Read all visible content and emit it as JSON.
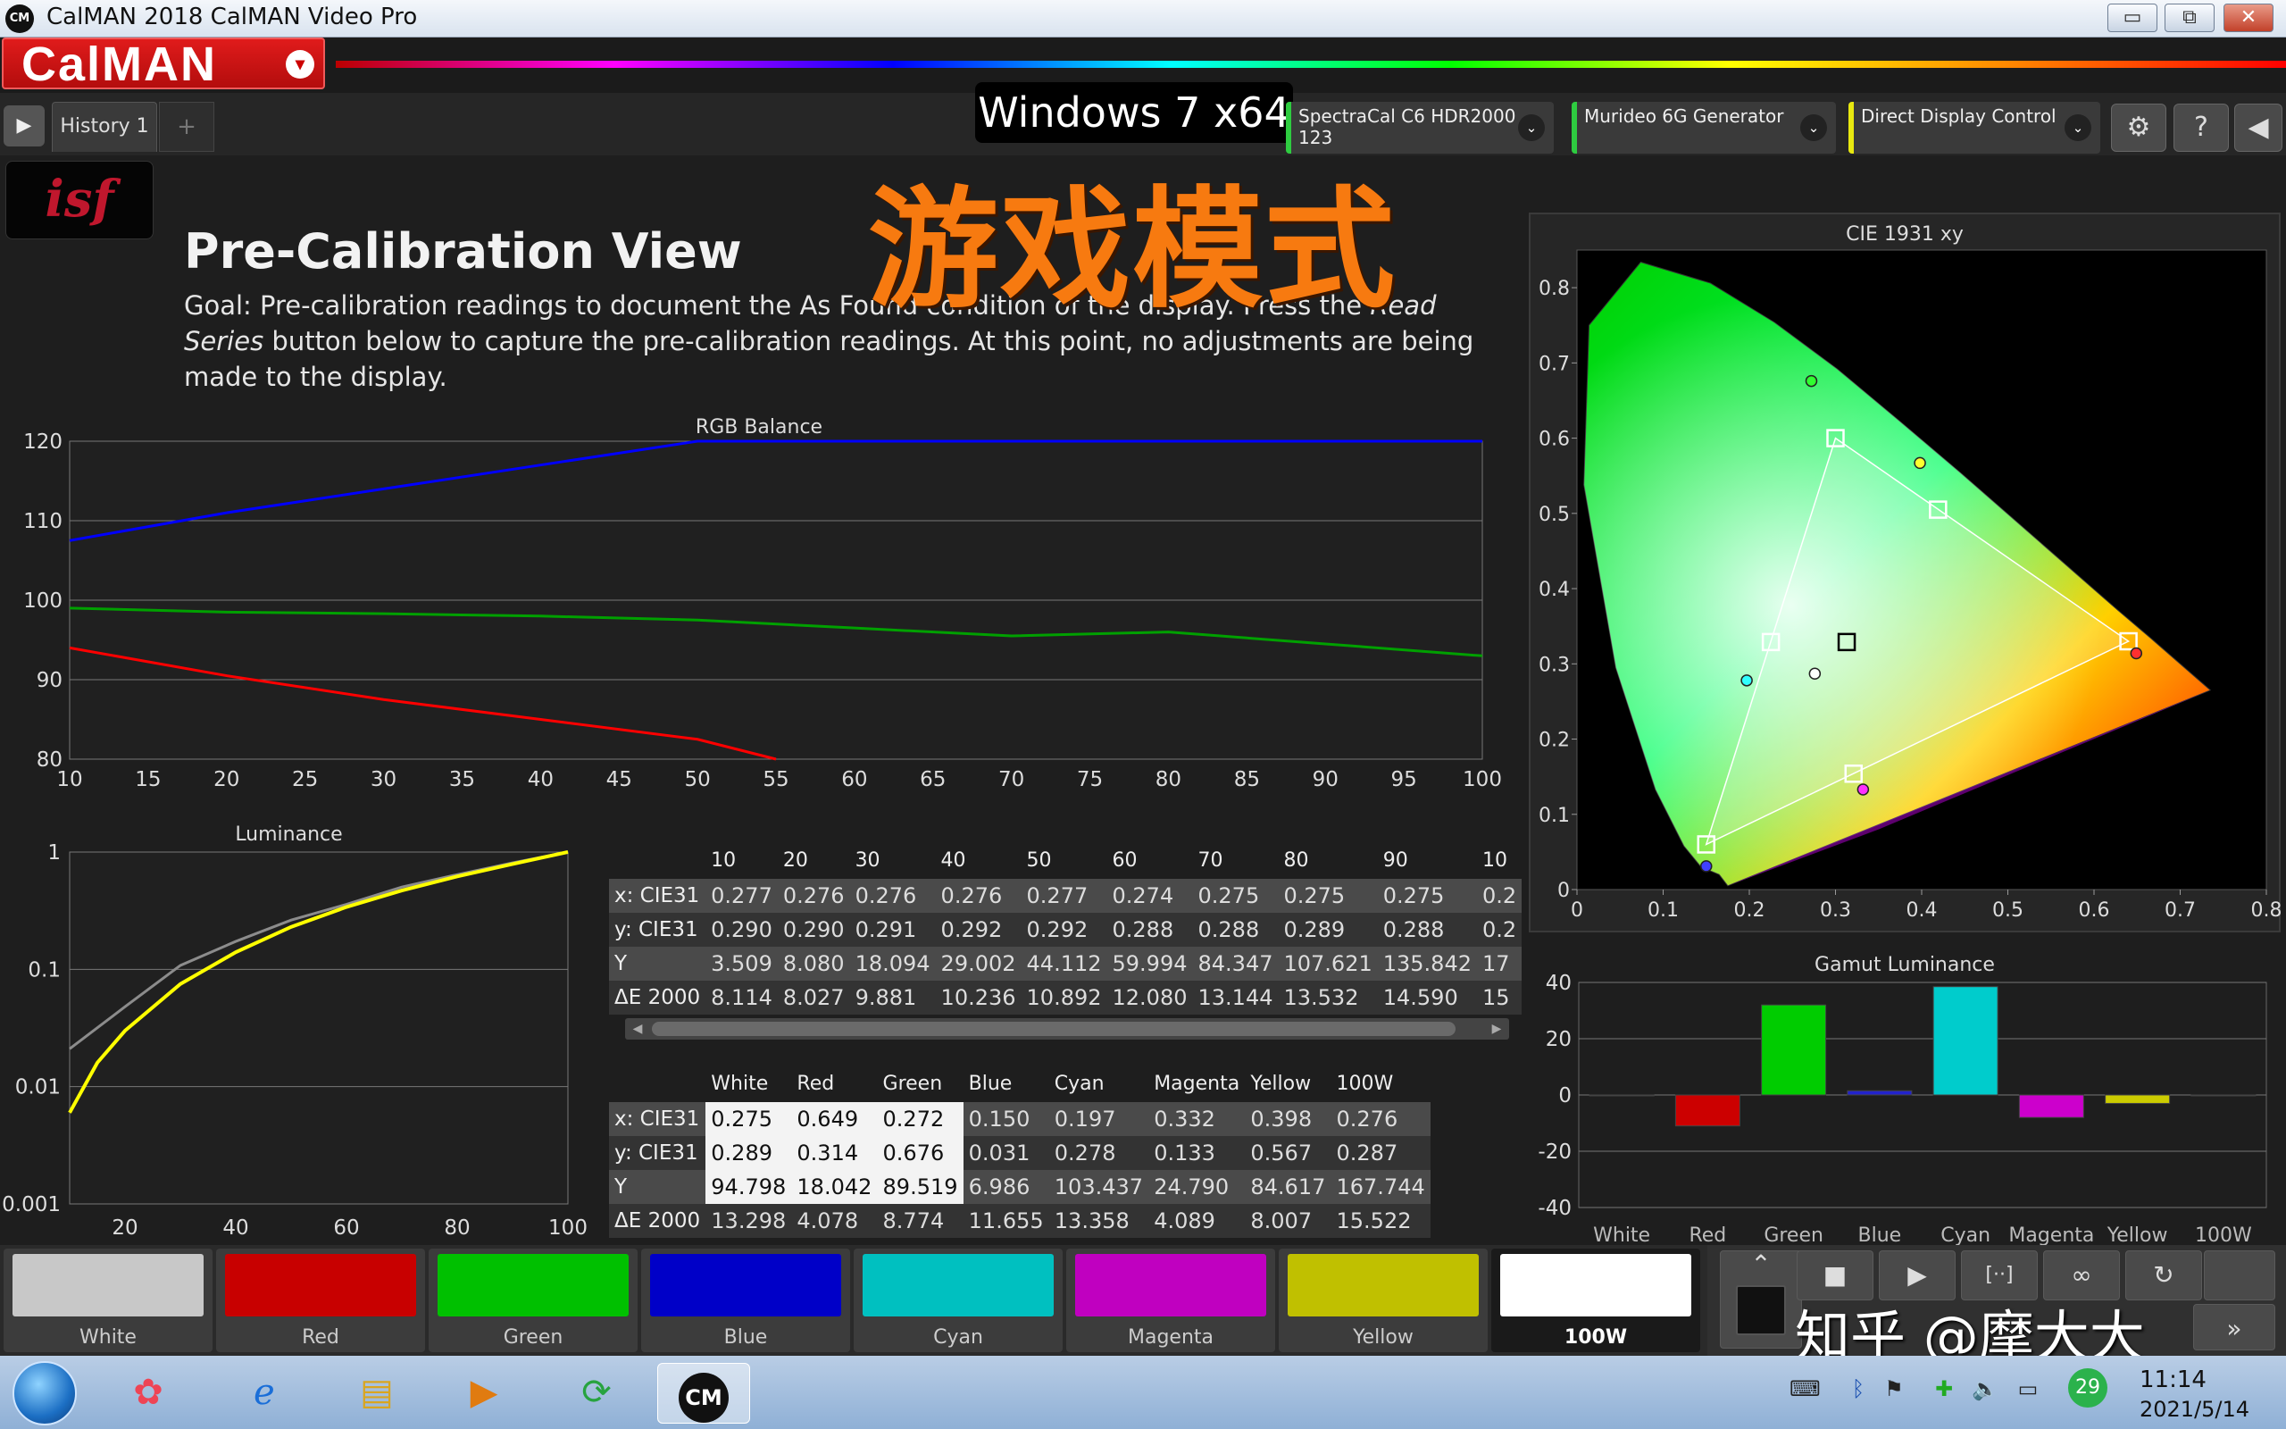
{
  "window": {
    "title": "CalMAN 2018 CalMAN Video Pro",
    "icon_text": "CM",
    "minimize": "▭",
    "restore": "⧉",
    "close": "✕"
  },
  "brand": {
    "logo": "CalMAN",
    "dropdown": "▾"
  },
  "tabs": {
    "play": "▶",
    "history": "History 1",
    "add": "+"
  },
  "os_label": "Windows 7 x64",
  "devices": [
    {
      "name": "SpectraCal C6 HDR2000",
      "sub": "123",
      "led": "#2ecc40"
    },
    {
      "name": "Murideo 6G Generator",
      "sub": "",
      "led": "#2ecc40"
    },
    {
      "name": "Direct Display Control",
      "sub": "",
      "led": "#e8e810"
    }
  ],
  "toolbar": {
    "settings": "⚙",
    "help": "?",
    "collapse": "◀",
    "dropdown": "⌄"
  },
  "isf_logo": "isf",
  "page": {
    "title": "Pre-Calibration View",
    "desc_before": "Goal: Pre-calibration readings to document the As Found condition of the display. Press the ",
    "desc_em": "Read Series",
    "desc_after": " button below to capture the pre-calibration readings. At this point, no adjustments are being made to the display."
  },
  "overlay_cn": "游戏模式",
  "rgb_balance": {
    "title": "RGB Balance",
    "x_ticks": [
      "10",
      "15",
      "20",
      "25",
      "30",
      "35",
      "40",
      "45",
      "50",
      "55",
      "60",
      "65",
      "70",
      "75",
      "80",
      "85",
      "90",
      "95",
      "100"
    ],
    "y_ticks": [
      "80",
      "90",
      "100",
      "110",
      "120"
    ]
  },
  "luminance": {
    "title": "Luminance",
    "x_ticks": [
      "20",
      "40",
      "60",
      "80",
      "100"
    ],
    "y_ticks": [
      "1",
      "0.1",
      "0.01",
      "0.001"
    ]
  },
  "cie": {
    "title": "CIE 1931 xy",
    "x_ticks": [
      "0",
      "0.1",
      "0.2",
      "0.3",
      "0.4",
      "0.5",
      "0.6",
      "0.7",
      "0.8"
    ],
    "y_ticks": [
      "0",
      "0.1",
      "0.2",
      "0.3",
      "0.4",
      "0.5",
      "0.6",
      "0.7",
      "0.8"
    ]
  },
  "gamut": {
    "title": "Gamut Luminance",
    "y_ticks": [
      "40",
      "20",
      "0",
      "-20",
      "-40"
    ],
    "categories": [
      "White",
      "Red",
      "Green",
      "Blue",
      "Cyan",
      "Magenta",
      "Yellow",
      "100W"
    ]
  },
  "chart_data": [
    {
      "type": "line",
      "title": "RGB Balance",
      "xlabel": "",
      "ylabel": "",
      "ylim": [
        80,
        120
      ],
      "xlim": [
        10,
        100
      ],
      "grid": true,
      "series": [
        {
          "color": "#0000ff",
          "x": [
            10,
            20,
            30,
            40,
            50,
            60,
            70,
            80,
            90,
            100
          ],
          "y": [
            107.5,
            111,
            114,
            117,
            120,
            120,
            120,
            120,
            120,
            120
          ]
        },
        {
          "color": "#00a000",
          "x": [
            10,
            20,
            30,
            40,
            50,
            60,
            70,
            80,
            90,
            100
          ],
          "y": [
            99,
            98.5,
            98.3,
            98,
            97.5,
            96.5,
            95.5,
            96,
            94.5,
            93
          ]
        },
        {
          "color": "#ff0000",
          "x": [
            10,
            20,
            30,
            40,
            50,
            55
          ],
          "y": [
            94,
            90.5,
            87.5,
            85,
            82.5,
            80
          ]
        }
      ]
    },
    {
      "type": "line",
      "title": "Luminance",
      "xlabel": "",
      "ylabel": "",
      "ylim": [
        0.001,
        1
      ],
      "xlim": [
        10,
        100
      ],
      "log_y": true,
      "grid": true,
      "series": [
        {
          "color": "#8c8c8c",
          "x": [
            10,
            20,
            30,
            40,
            50,
            60,
            70,
            80,
            90,
            100
          ],
          "y": [
            0.021,
            0.048,
            0.108,
            0.173,
            0.263,
            0.358,
            0.503,
            0.642,
            0.809,
            1
          ]
        },
        {
          "color": "#ffff00",
          "x": [
            10,
            15,
            20,
            30,
            40,
            50,
            60,
            70,
            80,
            90,
            100
          ],
          "y": [
            0.006,
            0.016,
            0.03,
            0.075,
            0.14,
            0.23,
            0.34,
            0.47,
            0.62,
            0.79,
            1
          ]
        }
      ]
    },
    {
      "type": "scatter",
      "title": "CIE 1931 xy",
      "xlim": [
        0,
        0.8
      ],
      "ylim": [
        0,
        0.8
      ],
      "targets": [
        {
          "name": "White",
          "x": 0.313,
          "y": 0.329
        },
        {
          "name": "Red",
          "x": 0.64,
          "y": 0.33
        },
        {
          "name": "Green",
          "x": 0.3,
          "y": 0.6
        },
        {
          "name": "Blue",
          "x": 0.15,
          "y": 0.06
        },
        {
          "name": "Cyan",
          "x": 0.225,
          "y": 0.329
        },
        {
          "name": "Magenta",
          "x": 0.321,
          "y": 0.154
        },
        {
          "name": "Yellow",
          "x": 0.419,
          "y": 0.505
        }
      ],
      "measured": [
        {
          "name": "White",
          "x": 0.276,
          "y": 0.287
        },
        {
          "name": "Red",
          "x": 0.649,
          "y": 0.314
        },
        {
          "name": "Green",
          "x": 0.272,
          "y": 0.676
        },
        {
          "name": "Blue",
          "x": 0.15,
          "y": 0.031
        },
        {
          "name": "Cyan",
          "x": 0.197,
          "y": 0.278
        },
        {
          "name": "Magenta",
          "x": 0.332,
          "y": 0.133
        },
        {
          "name": "Yellow",
          "x": 0.398,
          "y": 0.567
        }
      ]
    },
    {
      "type": "bar",
      "title": "Gamut Luminance",
      "categories": [
        "White",
        "Red",
        "Green",
        "Blue",
        "Cyan",
        "Magenta",
        "Yellow",
        "100W"
      ],
      "values": [
        0,
        -11,
        32,
        1.5,
        38.5,
        -8,
        -3,
        0
      ],
      "ylim": [
        -40,
        40
      ],
      "colors": [
        "#ffffff",
        "#cc0000",
        "#00cc00",
        "#2222cc",
        "#00cccc",
        "#cc00cc",
        "#cccc00",
        "#ffffff"
      ]
    }
  ],
  "table1": {
    "columns": [
      "",
      "10",
      "20",
      "30",
      "40",
      "50",
      "60",
      "70",
      "80",
      "90",
      "10"
    ],
    "rows": [
      [
        "x: CIE31",
        "0.277",
        "0.276",
        "0.276",
        "0.276",
        "0.277",
        "0.274",
        "0.275",
        "0.275",
        "0.275",
        "0.2"
      ],
      [
        "y: CIE31",
        "0.290",
        "0.290",
        "0.291",
        "0.292",
        "0.292",
        "0.288",
        "0.288",
        "0.289",
        "0.288",
        "0.2"
      ],
      [
        "Y",
        "3.509",
        "8.080",
        "18.094",
        "29.002",
        "44.112",
        "59.994",
        "84.347",
        "107.621",
        "135.842",
        "17"
      ],
      [
        "ΔE 2000",
        "8.114",
        "8.027",
        "9.881",
        "10.236",
        "10.892",
        "12.080",
        "13.144",
        "13.532",
        "14.590",
        "15"
      ]
    ]
  },
  "table2": {
    "columns": [
      "",
      "White",
      "Red",
      "Green",
      "Blue",
      "Cyan",
      "Magenta",
      "Yellow",
      "100W"
    ],
    "rows": [
      [
        "x: CIE31",
        "0.275",
        "0.649",
        "0.272",
        "0.150",
        "0.197",
        "0.332",
        "0.398",
        "0.276"
      ],
      [
        "y: CIE31",
        "0.289",
        "0.314",
        "0.676",
        "0.031",
        "0.278",
        "0.133",
        "0.567",
        "0.287"
      ],
      [
        "Y",
        "94.798",
        "18.042",
        "89.519",
        "6.986",
        "103.437",
        "24.790",
        "84.617",
        "167.744"
      ],
      [
        "ΔE 2000",
        "13.298",
        "4.078",
        "8.774",
        "11.655",
        "13.358",
        "4.089",
        "8.007",
        "15.522"
      ]
    ]
  },
  "swatches": [
    {
      "label": "White",
      "color": "#c8c8c8"
    },
    {
      "label": "Red",
      "color": "#c80000"
    },
    {
      "label": "Green",
      "color": "#00c000"
    },
    {
      "label": "Blue",
      "color": "#0000c8"
    },
    {
      "label": "Cyan",
      "color": "#00c0c0"
    },
    {
      "label": "Magenta",
      "color": "#c000c0"
    },
    {
      "label": "Yellow",
      "color": "#c0c000"
    },
    {
      "label": "100W",
      "color": "#ffffff"
    }
  ],
  "controls": {
    "stop": "■",
    "play": "▶",
    "read_series": "[··]",
    "continuous": "∞",
    "refresh": "↻",
    "next": "»"
  },
  "watermark": "知乎 @摩大大",
  "taskbar": {
    "time": "11:14",
    "date": "2021/5/14",
    "badge": "29",
    "cm": "CM"
  }
}
